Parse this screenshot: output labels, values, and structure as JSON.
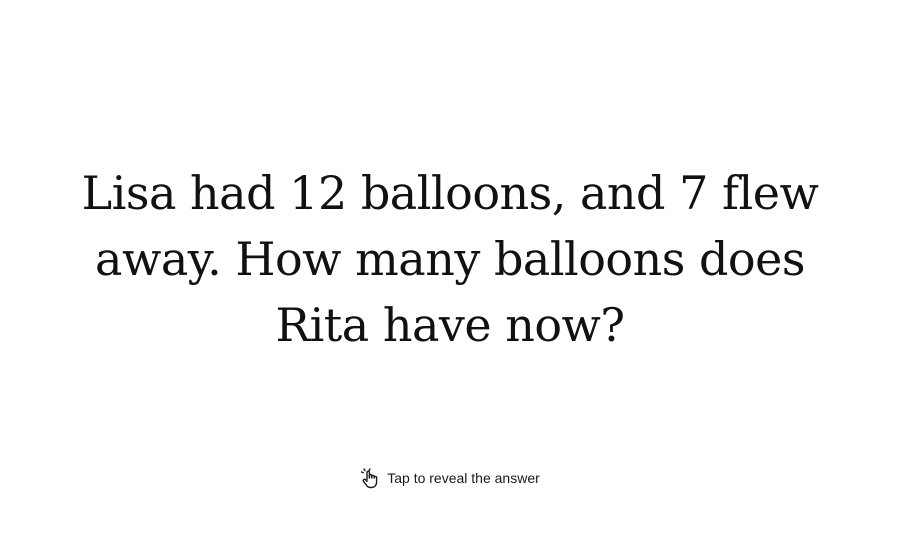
{
  "question": {
    "text": "Lisa had 12 balloons, and 7 flew away. How many balloons does Rita have now?"
  },
  "reveal": {
    "icon": "tap-hand-icon",
    "label": "Tap to reveal the answer"
  },
  "colors": {
    "background": "#ffffff",
    "text": "#111111"
  }
}
